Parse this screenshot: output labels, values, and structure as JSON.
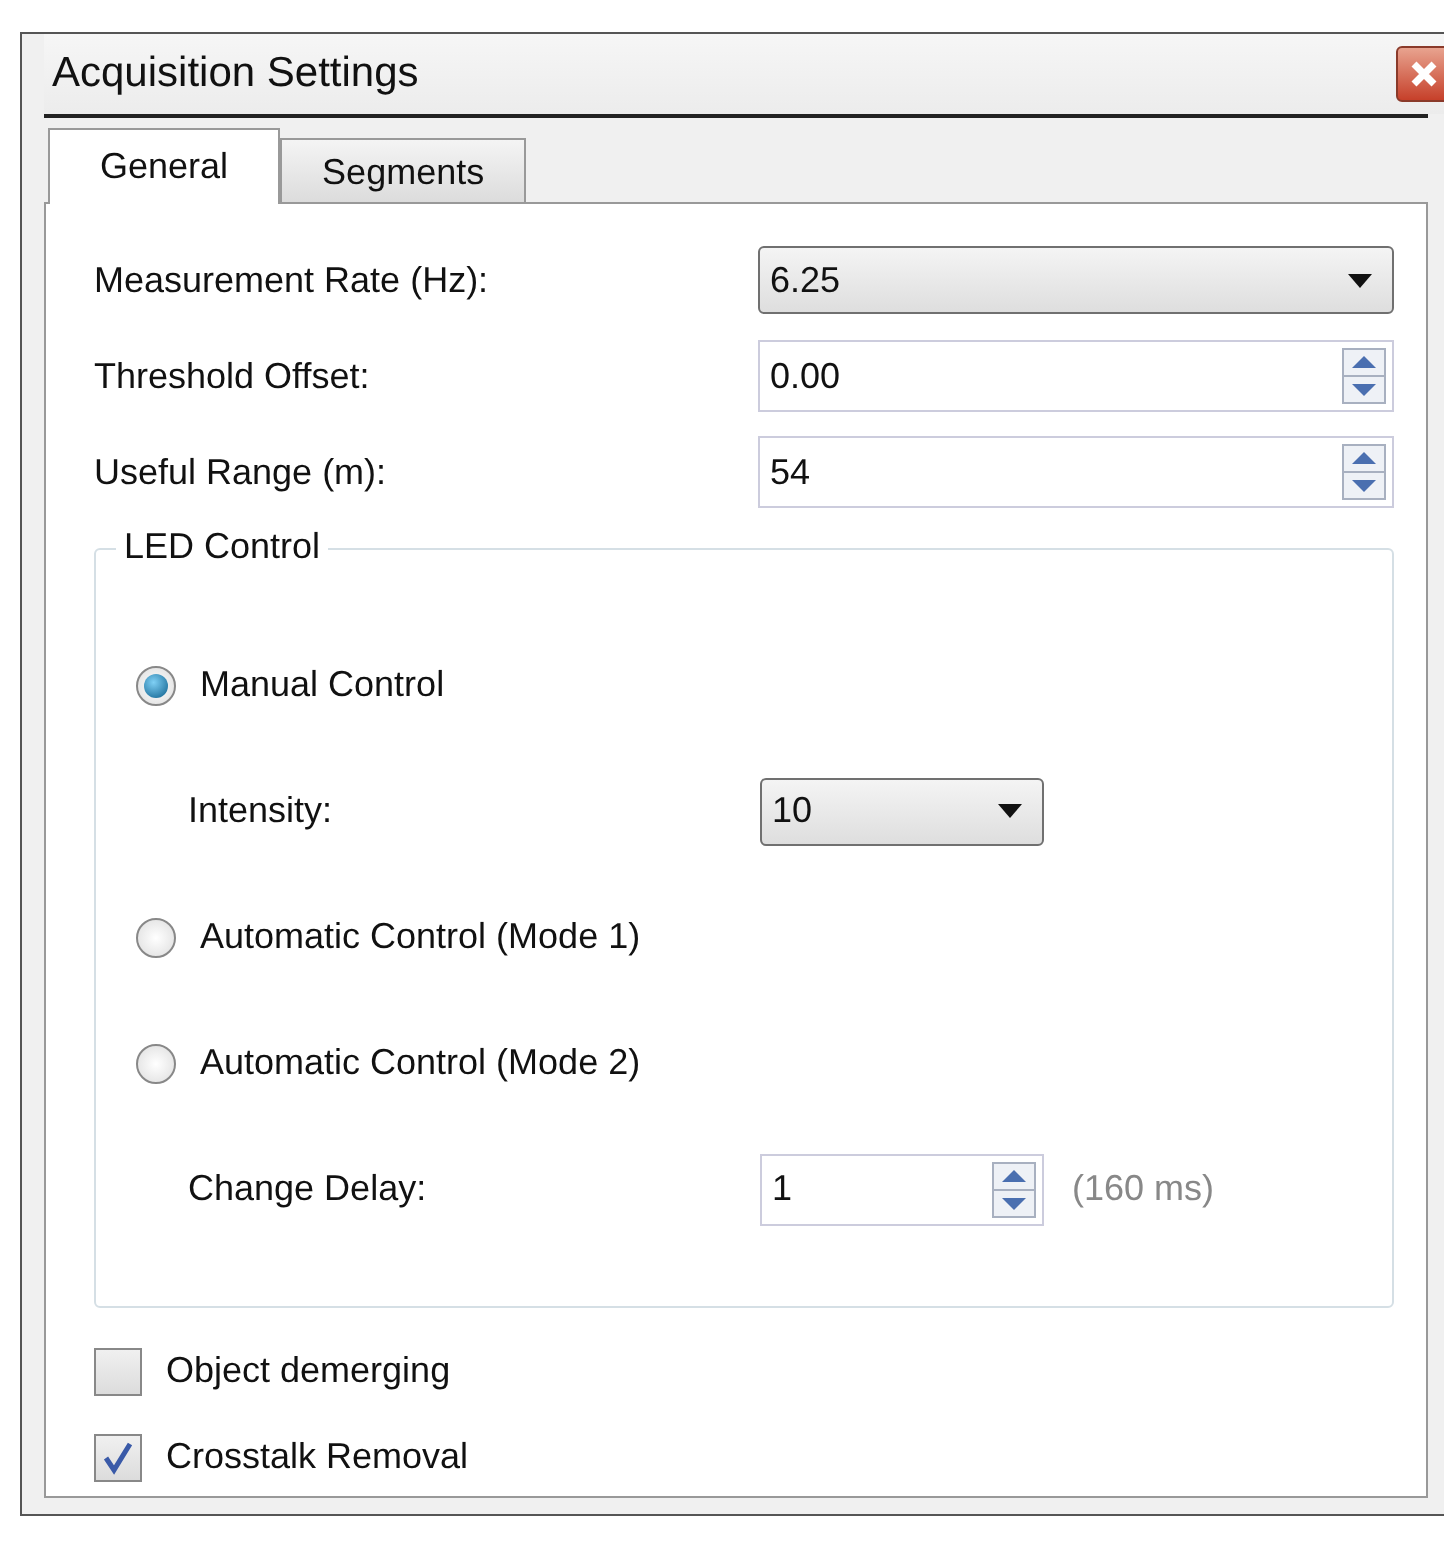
{
  "window": {
    "title": "Acquisition Settings"
  },
  "tabs": [
    {
      "label": "General",
      "selected": true
    },
    {
      "label": "Segments",
      "selected": false
    }
  ],
  "fields": [
    {
      "kind": "dropdown",
      "label": "Measurement Rate (Hz):",
      "value": "6.25"
    },
    {
      "kind": "spin",
      "label": "Threshold Offset:",
      "value": "0.00"
    },
    {
      "kind": "spin",
      "label": "Useful Range (m):",
      "value": "54"
    }
  ],
  "led_control": {
    "title": "LED Control",
    "items": [
      {
        "kind": "radio",
        "label": "Manual Control",
        "selected": true
      },
      {
        "kind": "dropdown",
        "label": "Intensity:",
        "value": "10"
      },
      {
        "kind": "radio",
        "label": "Automatic Control (Mode 1)",
        "selected": false
      },
      {
        "kind": "radio",
        "label": "Automatic Control (Mode 2)",
        "selected": false
      },
      {
        "kind": "spin",
        "label": "Change Delay:",
        "value": "1",
        "note": "(160 ms)"
      }
    ]
  },
  "checkboxes": [
    {
      "label": "Object demerging",
      "checked": false
    },
    {
      "label": "Crosstalk Removal",
      "checked": true
    }
  ]
}
